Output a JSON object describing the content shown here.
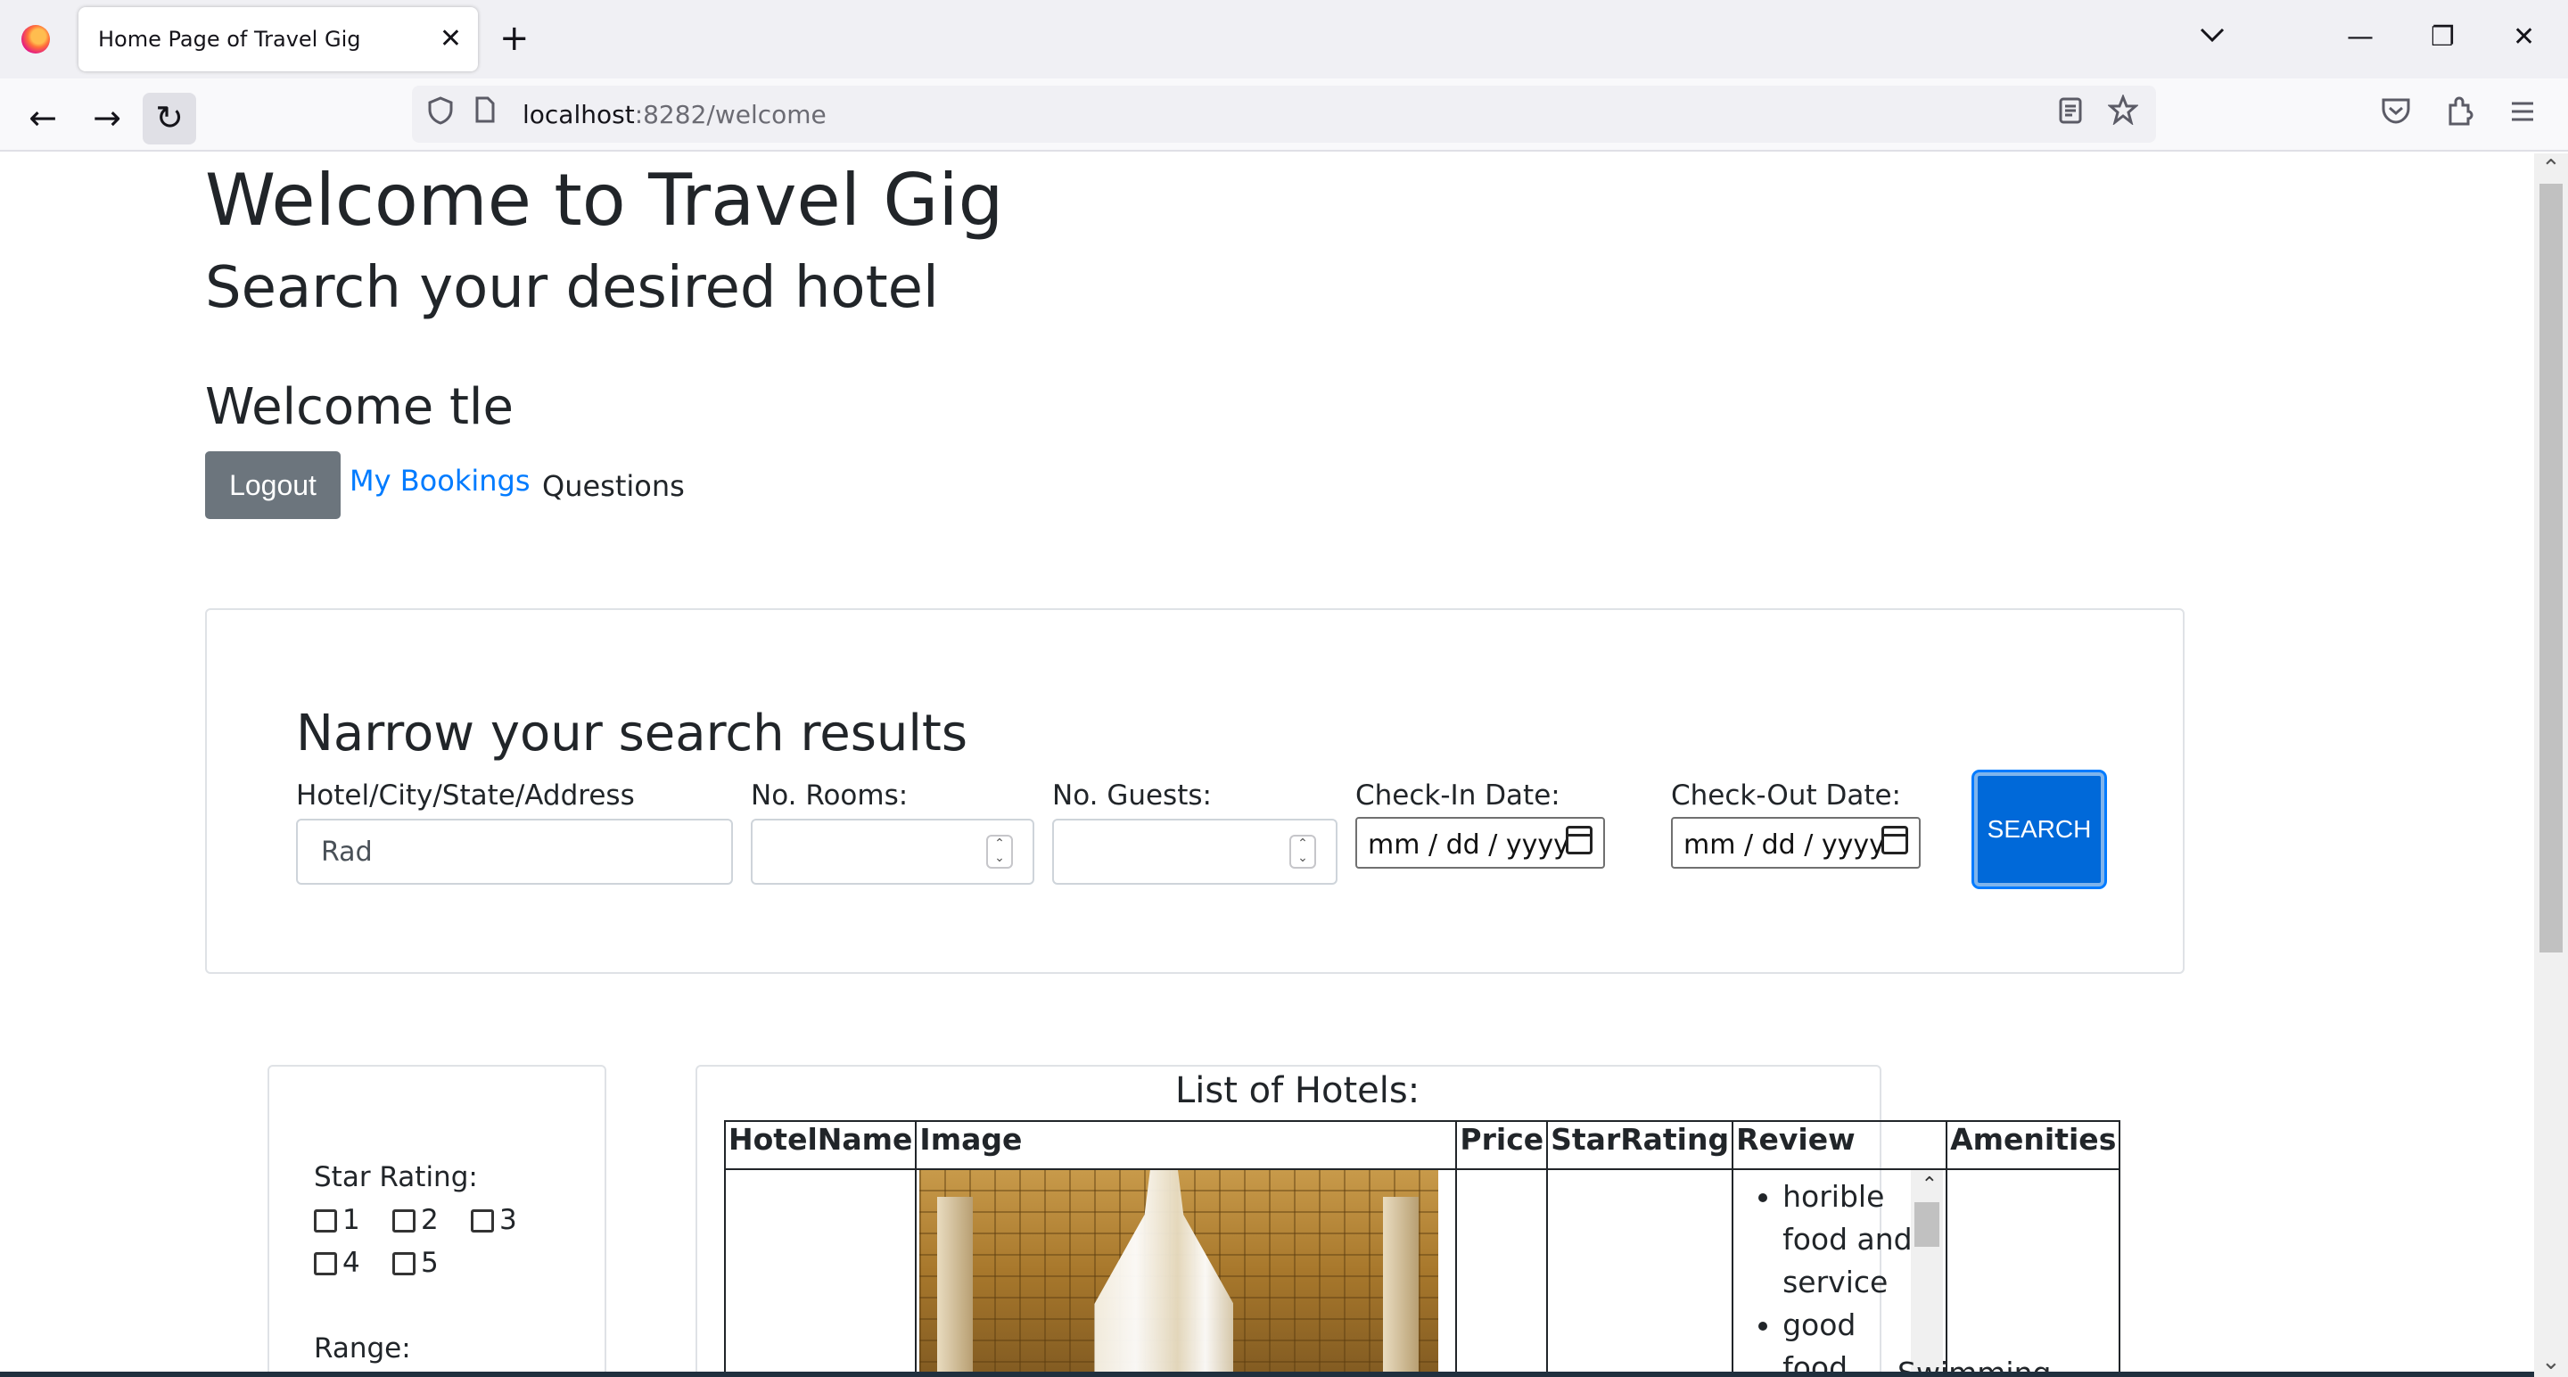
{
  "browser": {
    "tab_title": "Home Page of Travel Gig",
    "tab_close": "✕",
    "new_tab": "+",
    "tab_list": "⌄",
    "window": {
      "minimize": "—",
      "restore": "❐",
      "close": "✕"
    },
    "nav": {
      "back": "←",
      "forward": "→",
      "reload": "↻"
    },
    "url_host": "localhost",
    "url_rest": ":8282/welcome",
    "icons": [
      "shield-icon",
      "page-icon",
      "reader-view-icon",
      "bookmark-star-icon",
      "pocket-icon",
      "extensions-icon",
      "menu-icon"
    ]
  },
  "page": {
    "title": "Welcome to Travel Gig",
    "subtitle": "Search your desired hotel",
    "welcome_user": "Welcome tle",
    "logout_label": "Logout",
    "bookings_link": "My Bookings",
    "questions_link": "Questions"
  },
  "search": {
    "heading": "Narrow your search results",
    "hotel_label": "Hotel/City/State/Address",
    "hotel_value": "Rad",
    "rooms_label": "No. Rooms:",
    "guests_label": "No. Guests:",
    "checkin_label": "Check-In Date:",
    "checkin_placeholder": "mm / dd / yyyy",
    "checkout_label": "Check-Out Date:",
    "checkout_placeholder": "mm / dd / yyyy",
    "search_button": "SEARCH"
  },
  "filters": {
    "star_label": "Star Rating:",
    "stars": [
      "1",
      "2",
      "3",
      "4",
      "5"
    ],
    "range_label": "Range:"
  },
  "hotels": {
    "heading": "List of Hotels:",
    "columns": [
      "HotelName",
      "Image",
      "Price",
      "StarRating",
      "Review",
      "Amenities"
    ],
    "reviews": [
      "horible food and service",
      "good food, nice"
    ],
    "amenities_partial": "Swimming"
  },
  "colors": {
    "primary": "#007bff",
    "secondary": "#6c757d",
    "border": "#dfe2e6"
  }
}
